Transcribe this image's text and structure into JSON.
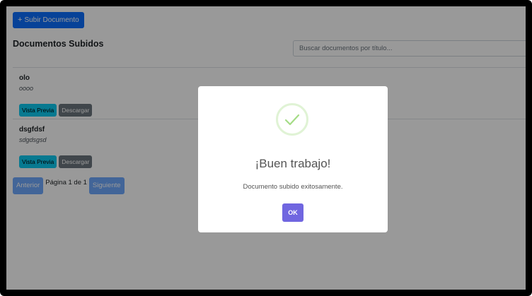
{
  "toolbar": {
    "upload_label": "Subir Documento",
    "upload_icon": "plus-icon",
    "primary_color": "#0d6efd"
  },
  "documents": {
    "section_title": "Documentos Subidos",
    "search_placeholder": "Buscar documentos por título...",
    "items": [
      {
        "title": "olo",
        "description": "oooo",
        "preview_label": "Vista Previa",
        "download_label": "Descargar"
      },
      {
        "title": "dsgfdsf",
        "description": "sdgdsgsd",
        "preview_label": "Vista Previa",
        "download_label": "Descargar"
      }
    ]
  },
  "pagination": {
    "prev_label": "Anterior",
    "page_info": "Página 1 de 1",
    "next_label": "Siguiente"
  },
  "modal": {
    "icon": "success-check-icon",
    "icon_color": "#a5dc86",
    "title": "¡Buen trabajo!",
    "text": "Documento subido exitosamente.",
    "ok_label": "OK",
    "ok_color": "#7066e0"
  }
}
